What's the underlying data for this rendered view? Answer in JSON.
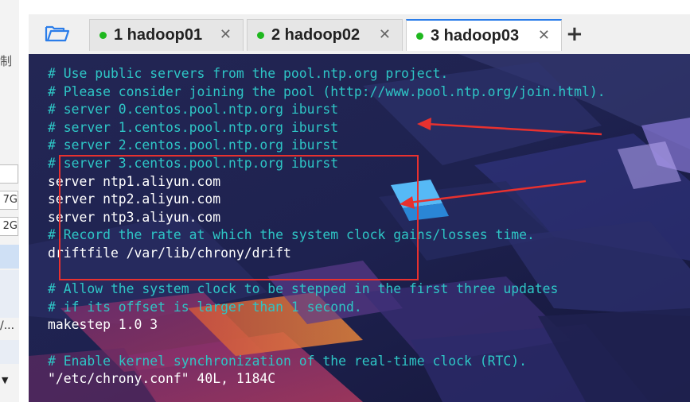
{
  "left_panel": {
    "label_fragment": "制",
    "box_values": [
      "",
      "7G",
      "2G"
    ],
    "text_fragment": "/..."
  },
  "tabs": [
    {
      "label": "1 hadoop01",
      "status_color": "#1fb81f",
      "active": false
    },
    {
      "label": "2 hadoop02",
      "status_color": "#1fb81f",
      "active": false
    },
    {
      "label": "3 hadoop03",
      "status_color": "#1fb81f",
      "active": true
    }
  ],
  "tab_close_symbol": "✕",
  "new_tab_symbol": "+",
  "icons": {
    "open_folder": "folder-icon",
    "add_tab": "plus-icon",
    "close_tab": "close-icon"
  },
  "terminal": {
    "lines": [
      {
        "text": "# Use public servers from the pool.ntp.org project.",
        "style": "comment"
      },
      {
        "text": "# Please consider joining the pool (http://www.pool.ntp.org/join.html).",
        "style": "comment"
      },
      {
        "text": "# server 0.centos.pool.ntp.org iburst",
        "style": "comment"
      },
      {
        "text": "# server 1.centos.pool.ntp.org iburst",
        "style": "comment"
      },
      {
        "text": "# server 2.centos.pool.ntp.org iburst",
        "style": "comment"
      },
      {
        "text": "# server 3.centos.pool.ntp.org iburst",
        "style": "comment"
      },
      {
        "text": "server ntp1.aliyun.com",
        "style": "normal"
      },
      {
        "text": "server ntp2.aliyun.com",
        "style": "normal"
      },
      {
        "text": "server ntp3.aliyun.com",
        "style": "normal"
      },
      {
        "text": "# Record the rate at which the system clock gains/losses time.",
        "style": "comment"
      },
      {
        "text": "driftfile /var/lib/chrony/drift",
        "style": "normal"
      },
      {
        "text": "",
        "style": "normal"
      },
      {
        "text": "# Allow the system clock to be stepped in the first three updates",
        "style": "comment"
      },
      {
        "text": "# if its offset is larger than 1 second.",
        "style": "comment"
      },
      {
        "text": "makestep 1.0 3",
        "style": "normal"
      },
      {
        "text": "",
        "style": "normal"
      },
      {
        "text": "# Enable kernel synchronization of the real-time clock (RTC).",
        "style": "comment"
      },
      {
        "text": "\"/etc/chrony.conf\" 40L, 1184C",
        "style": "normal"
      }
    ],
    "comment_color": "#2ec6c6",
    "text_color": "#ffffff",
    "annotation_color": "#e8312f"
  }
}
